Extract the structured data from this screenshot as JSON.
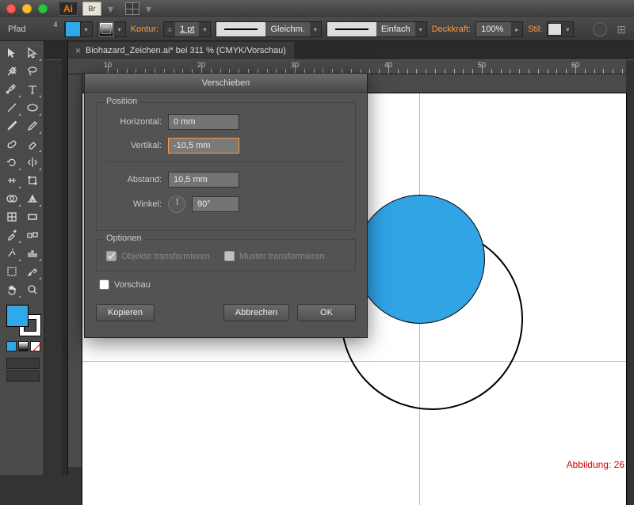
{
  "titlebar": {
    "ai": "Ai",
    "br": "Br"
  },
  "control": {
    "path": "Pfad",
    "kontur": "Kontur:",
    "kontur_val": "1 pt",
    "mode1": "Gleichm.",
    "mode2": "Einfach",
    "deckkraft": "Deckkraft:",
    "deckkraft_val": "100%",
    "stil": "Stil:"
  },
  "doc": {
    "title": "Biohazard_Zeichen.ai* bei 311 % (CMYK/Vorschau)",
    "toolcol": "4"
  },
  "dialog": {
    "title": "Verschieben",
    "position": "Position",
    "horizontal": "Horizontal:",
    "h_val": "0 mm",
    "vertikal": "Vertikal:",
    "v_val": "-10,5 mm",
    "abstand": "Abstand:",
    "a_val": "10,5 mm",
    "winkel": "Winkel:",
    "w_val": "90°",
    "optionen": "Optionen",
    "objekte": "Objekte transformieren",
    "muster": "Muster transformieren",
    "vorschau": "Vorschau",
    "kopieren": "Kopieren",
    "abbrechen": "Abbrechen",
    "ok": "OK"
  },
  "ruler": {
    "marks": [
      "10",
      "20",
      "30",
      "40",
      "50",
      "60"
    ]
  },
  "caption": "Abbildung: 26",
  "colors": {
    "accent": "#ff9a3c",
    "cyan": "#2fa9e9",
    "guide": "#7ad9d9"
  }
}
